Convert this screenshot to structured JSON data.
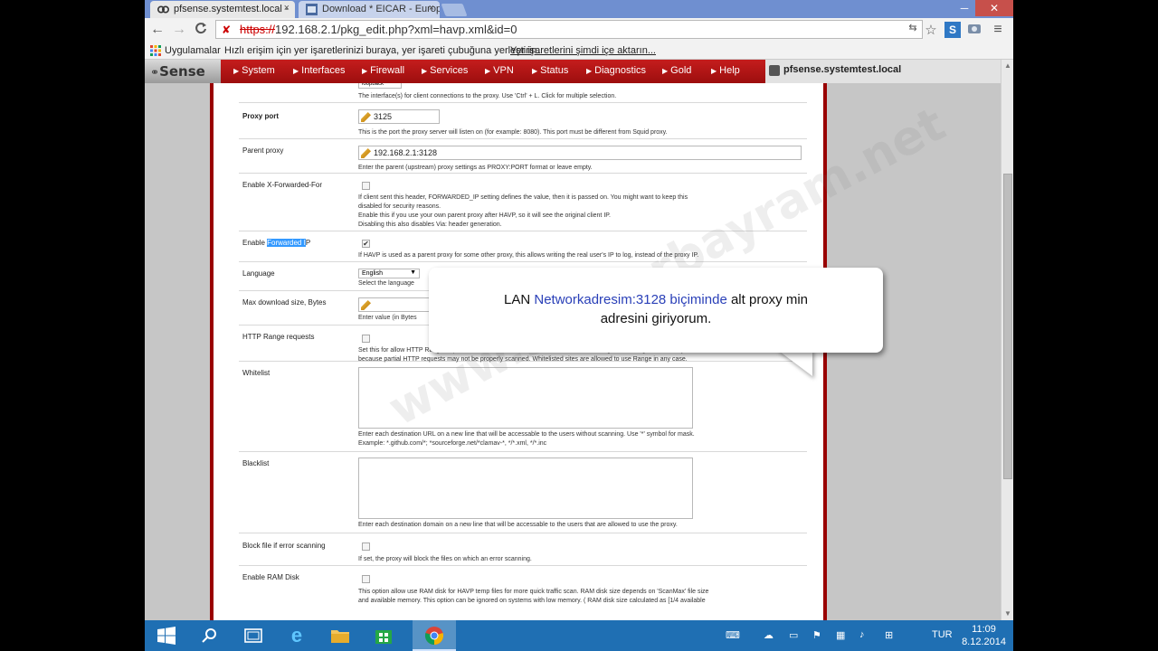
{
  "browser": {
    "tabs": [
      {
        "title": "pfsense.systemtest.local -",
        "close": "×"
      },
      {
        "title": "Download * EICAR - Europ",
        "close": "×"
      }
    ],
    "window_controls": [
      "─",
      "❐",
      "✕"
    ],
    "nav": {
      "back": "←",
      "forward": "→",
      "reload": "C"
    },
    "address": {
      "scheme": "https://",
      "rest": "192.168.2.1/pkg_edit.php?xml=havp.xml&id=0"
    },
    "bookmarks_bar": {
      "apps_label": "Uygulamalar",
      "hint_text": "Hızlı erişim için yer işaretlerinizi buraya, yer işareti çubuğuna yerleştirin.",
      "import_link": "Yer işaretlerini şimdi içe aktarın..."
    }
  },
  "pfsense": {
    "logo_text": "Sense",
    "menu": [
      "System",
      "Interfaces",
      "Firewall",
      "Services",
      "VPN",
      "Status",
      "Diagnostics",
      "Gold",
      "Help"
    ],
    "hostname": "pfsense.systemtest.local"
  },
  "form": {
    "top_select_value": "loopback",
    "top_desc": "The interface(s) for client connections to the proxy. Use 'Ctrl' + L. Click for multiple selection.",
    "proxy_port": {
      "label": "Proxy port",
      "value": "3125",
      "desc": "This is the port the proxy server will listen on (for example: 8080). This port must be different from Squid proxy."
    },
    "parent_proxy": {
      "label": "Parent proxy",
      "value": "192.168.2.1:3128",
      "desc": "Enter the parent (upstream) proxy settings as PROXY:PORT format or leave empty."
    },
    "x_forwarded": {
      "label": "Enable X-Forwarded-For",
      "desc1": "If client sent this header, FORWARDED_IP setting defines the value, then it is passed on. You might want to keep this",
      "desc2": "disabled for security reasons.",
      "desc3": "Enable this if you use your own parent proxy after HAVP, so it will see the original client IP.",
      "desc4": "Disabling this also disables Via: header generation."
    },
    "forwarded_ip": {
      "label_pre": "Enable ",
      "label_hl": "Forwarded I",
      "label_post": "P",
      "checked": "✔",
      "desc": "If HAVP is used as a parent proxy for some other proxy, this allows writing the real user's IP to log, instead of the proxy IP."
    },
    "language": {
      "label": "Language",
      "value": "English",
      "dd": "▼",
      "desc": "Select the language"
    },
    "max_download": {
      "label": "Max download size, Bytes",
      "desc": "Enter value (in Bytes"
    },
    "http_range": {
      "label": "HTTP Range requests",
      "desc1": "Set this for allow HTTP Range requests, and broken downloads can be resumed. Allowing HTTP Range is a security ris",
      "desc2": "because partial HTTP requests may not be properly scanned. Whitelisted sites are allowed to use Range in any case."
    },
    "whitelist": {
      "label": "Whitelist",
      "desc1": "Enter each destination URL on a new line that will be accessable to the users without scanning. Use '*' symbol for mask.",
      "desc2": "Example: *.github.com/*; *sourceforge.net/*clamav-*, */*.xml, */*.inc"
    },
    "blacklist": {
      "label": "Blacklist",
      "desc": "Enter each destination domain on a new line that will be accessable to the users that are allowed to use the proxy."
    },
    "block_error": {
      "label": "Block file if error scanning",
      "desc": "If set, the proxy will block the files on which an error scanning."
    },
    "ram_disk": {
      "label": "Enable RAM Disk",
      "desc1": "This option allow use RAM disk for HAVP temp files for more quick traffic scan. RAM disk size depends on 'ScanMax' file size",
      "desc2": "and available memory. This option can be ignored on systems with low memory. ( RAM disk size calculated as [1/4 available"
    }
  },
  "callout": {
    "part1": "LAN ",
    "part2": "Networkadresim:3128 biçiminde",
    "part3": " alt proxy min",
    "line2": "adresini giriyorum."
  },
  "watermark": "www.serdarbayram.net",
  "taskbar": {
    "lang": "TUR",
    "time": "11:09",
    "date": "8.12.2014"
  }
}
